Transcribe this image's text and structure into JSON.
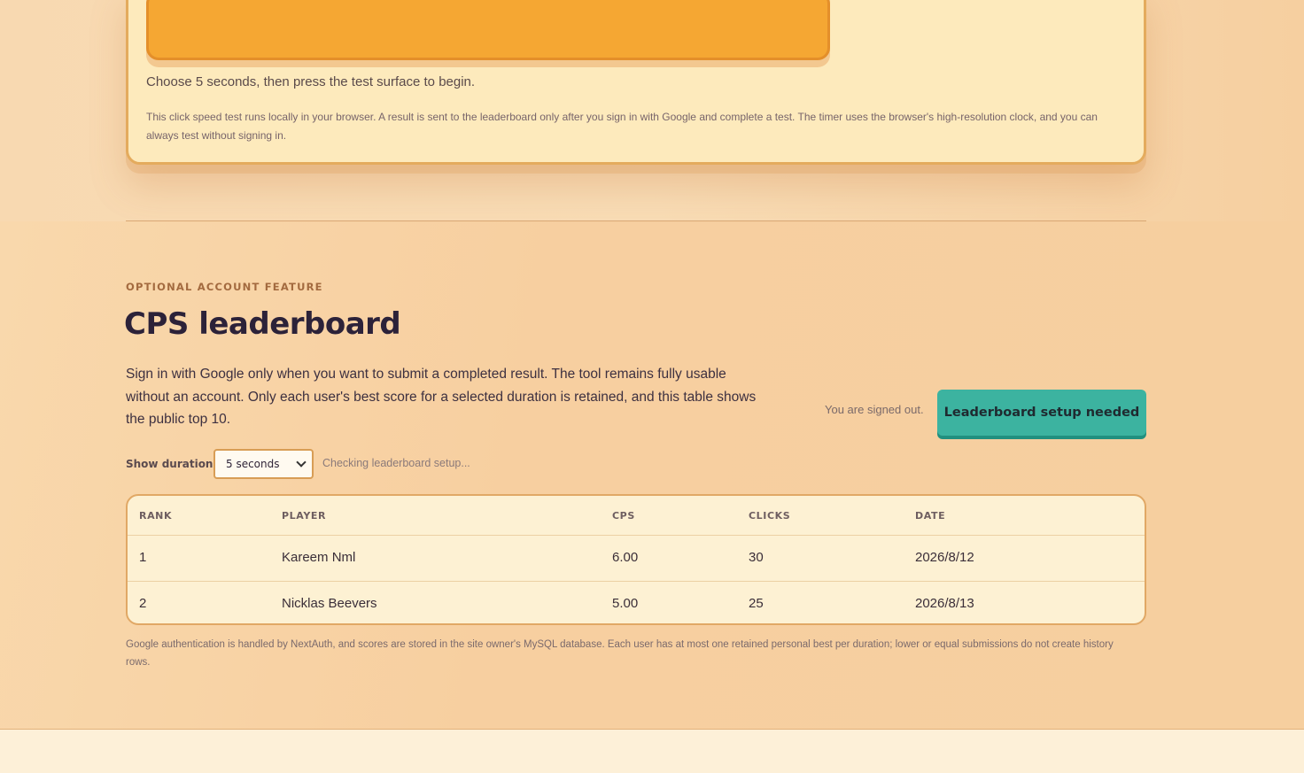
{
  "test_card": {
    "hint": "Choose 5 seconds, then press the test surface to begin.",
    "note": "This click speed test runs locally in your browser. A result is sent to the leaderboard only after you sign in with Google and complete a test. The timer uses the browser's high-resolution clock, and you can always test without signing in."
  },
  "leaderboard": {
    "eyebrow": "OPTIONAL ACCOUNT FEATURE",
    "title": "CPS leaderboard",
    "description": "Sign in with Google only when you want to submit a completed result. The tool remains fully usable without an account. Only each user's best score for a selected duration is retained, and this table shows the public top 10.",
    "signed_out_text": "You are signed out.",
    "setup_button_label": "Leaderboard setup needed",
    "duration_label": "Show duration",
    "duration_selected": "5 seconds",
    "status_text": "Checking leaderboard setup...",
    "columns": [
      "RANK",
      "PLAYER",
      "CPS",
      "CLICKS",
      "DATE"
    ],
    "rows": [
      {
        "rank": "1",
        "player": "Kareem Nml",
        "cps": "6.00",
        "clicks": "30",
        "date": "2026/8/12"
      },
      {
        "rank": "2",
        "player": "Nicklas Beevers",
        "cps": "5.00",
        "clicks": "25",
        "date": "2026/8/13"
      }
    ],
    "footnote": "Google authentication is handled by NextAuth, and scores are stored in the site owner's MySQL database. Each user has at most one retained personal best per duration; lower or equal submissions do not create history rows."
  },
  "colors": {
    "accent_orange": "#f5a733",
    "teal_button": "#3cb3a0",
    "card_bg": "#fdeabc"
  }
}
